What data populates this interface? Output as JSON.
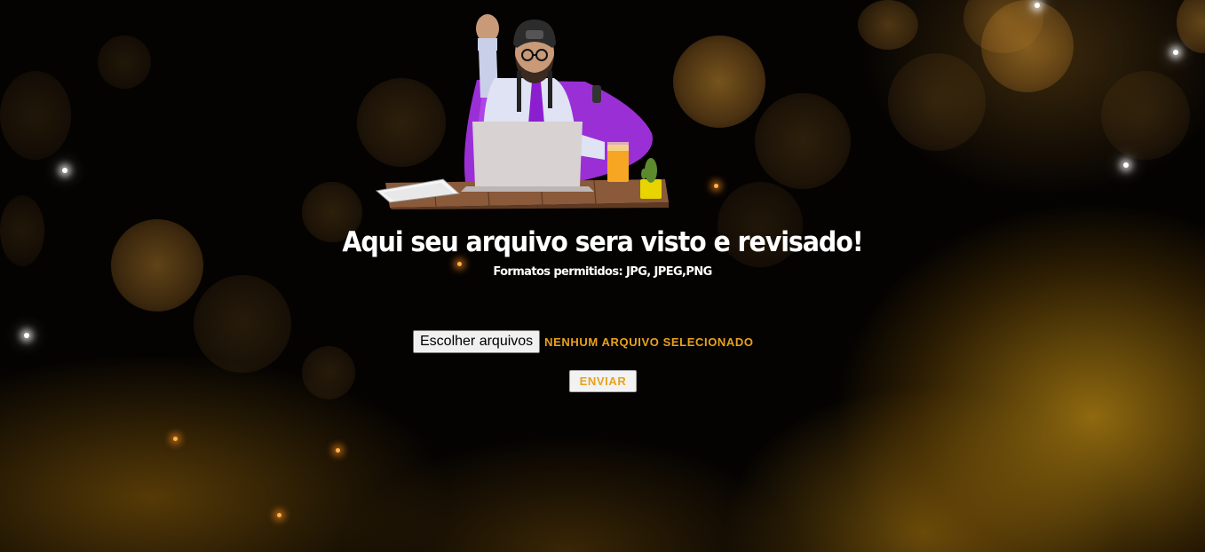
{
  "page": {
    "title": "Aqui seu arquivo sera visto e revisado!",
    "subtitle": "Formatos permitidos: JPG, JPEG,PNG"
  },
  "upload": {
    "choose_label": "Escolher arquivos",
    "status": "NENHUM ARQUIVO SELECIONADO",
    "submit_label": "ENVIAR"
  },
  "colors": {
    "accent": "#e8a21c",
    "background": "#000000",
    "title_text": "#ffffff"
  },
  "icons": {
    "hero": "superhero-office-worker-illustration"
  }
}
